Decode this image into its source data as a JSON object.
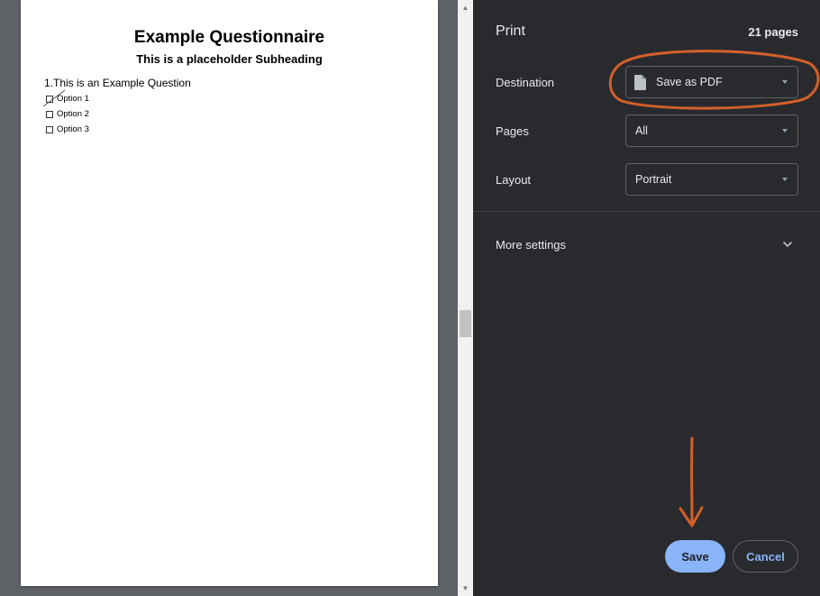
{
  "document": {
    "title": "Example Questionnaire",
    "subheading": "This is a placeholder Subheading",
    "question": "1.This is an Example Question",
    "options": [
      "Option 1",
      "Option 2",
      "Option 3"
    ]
  },
  "print_panel": {
    "title": "Print",
    "page_count": "21 pages",
    "destination": {
      "label": "Destination",
      "value": "Save as PDF",
      "icon": "file-icon"
    },
    "pages": {
      "label": "Pages",
      "value": "All"
    },
    "layout": {
      "label": "Layout",
      "value": "Portrait"
    },
    "more_settings": "More settings",
    "save_label": "Save",
    "cancel_label": "Cancel"
  },
  "colors": {
    "panel_bg": "#292a2d",
    "accent": "#8ab4f8",
    "annotation": "#d2602a",
    "preview_bg": "#5f6368"
  }
}
